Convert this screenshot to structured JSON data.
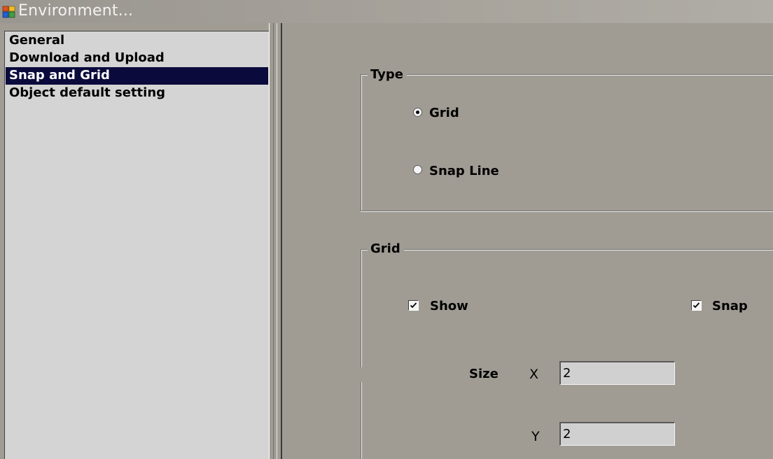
{
  "window": {
    "title": "Environment..."
  },
  "nav": {
    "items": [
      {
        "label": "General",
        "selected": false
      },
      {
        "label": "Download and Upload",
        "selected": false
      },
      {
        "label": "Snap and Grid",
        "selected": true
      },
      {
        "label": "Object default setting",
        "selected": false
      }
    ]
  },
  "type_group": {
    "legend": "Type",
    "grid_label": "Grid",
    "grid_selected": true,
    "snapline_label": "Snap Line",
    "snapline_selected": false
  },
  "grid_group": {
    "legend": "Grid",
    "show_label": "Show",
    "show_checked": true,
    "snap_label": "Snap",
    "snap_checked": true,
    "size_label": "Size",
    "x_label": "X",
    "x_value": "2",
    "y_label": "Y",
    "y_value": "2"
  },
  "colors": {
    "dialog_background": "#a09c94",
    "list_background": "#d4d4d4",
    "selection_background": "#0a0a3c"
  },
  "icons": {
    "app": "app-window-icon",
    "check": "checkmark-icon",
    "radio_dot": "radio-dot-icon"
  }
}
